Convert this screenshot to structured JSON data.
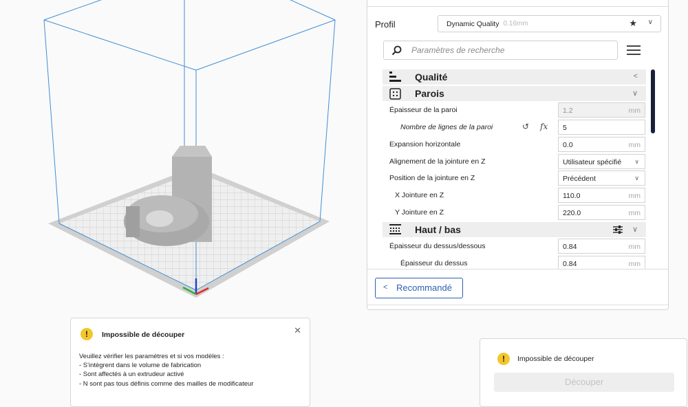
{
  "profile": {
    "label": "Profil",
    "name": "Dynamic Quality",
    "layer_height": "0.16mm"
  },
  "search": {
    "placeholder": "Paramètres de recherche"
  },
  "settings": {
    "categories": {
      "quality": "Qualité",
      "walls": "Parois",
      "top_bottom": "Haut / bas"
    },
    "rows": [
      {
        "label": "Épaisseur de la paroi",
        "value": "1.2",
        "unit": "mm"
      },
      {
        "label": "Nombre de lignes de la paroi",
        "value": "5"
      },
      {
        "label": "Expansion horizontale",
        "value": "0.0",
        "unit": "mm"
      },
      {
        "label": "Alignement de la jointure en Z",
        "value": "Utilisateur spécifié"
      },
      {
        "label": "Position de la jointure en Z",
        "value": "Précédent"
      },
      {
        "label": "X Jointure en Z",
        "value": "110.0",
        "unit": "mm"
      },
      {
        "label": "Y Jointure en Z",
        "value": "220.0",
        "unit": "mm"
      },
      {
        "label": "Épaisseur du dessus/dessous",
        "value": "0.84",
        "unit": "mm"
      },
      {
        "label": "Épaisseur du dessus",
        "value": "0.84",
        "unit": "mm"
      }
    ],
    "formula_glyph": "fx"
  },
  "recommended_label": "Recommandé",
  "message": {
    "title": "Impossible de découper",
    "body_intro": "Veuillez vérifier les paramètres et si vos modèles :",
    "bullets": [
      "- S'intègrent dans le volume de fabrication",
      "- Sont affectés à un extrudeur activé",
      "- N sont pas tous définis comme des mailles de modificateur"
    ]
  },
  "action": {
    "status": "Impossible de découper",
    "slice_label": "Découper"
  },
  "colors": {
    "accent": "#2c5fb2",
    "warning": "#f3c62b",
    "build_volume": "#3f8ed6",
    "scrollbar": "#1a1f3a"
  }
}
